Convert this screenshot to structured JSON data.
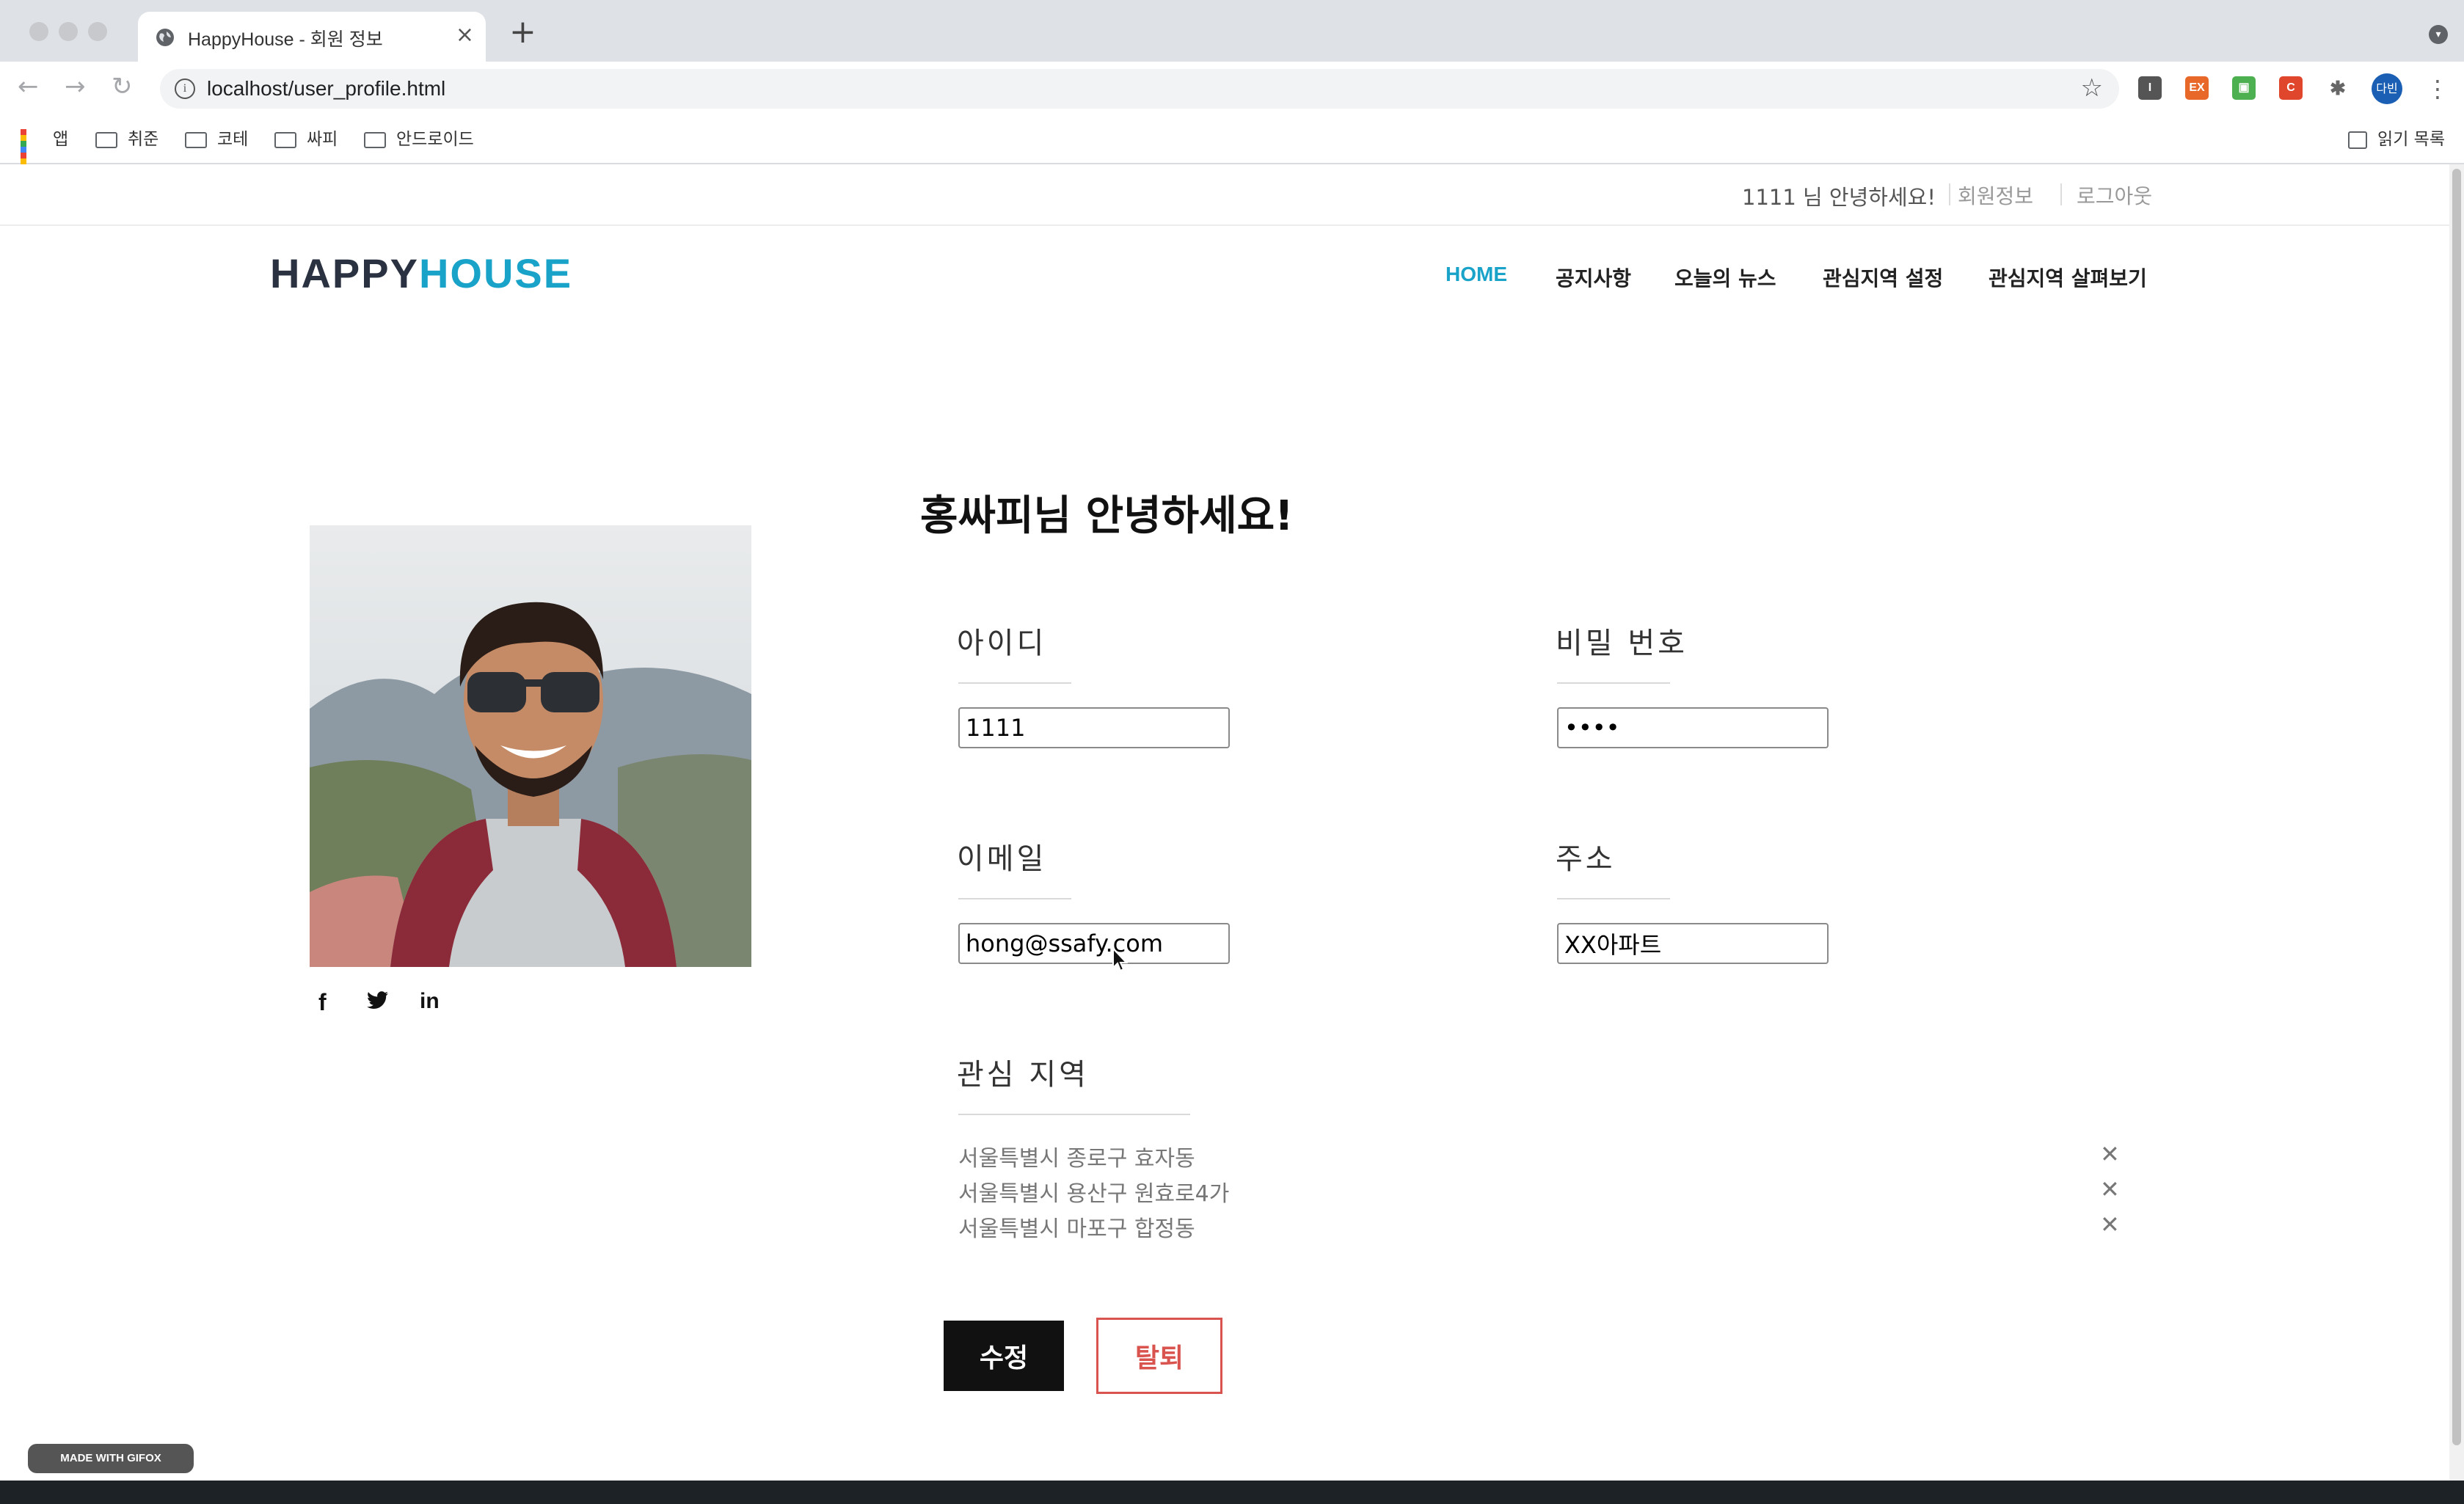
{
  "browser": {
    "tab_title": "HappyHouse - 회원 정보",
    "url": "localhost/user_profile.html",
    "profile_label": "다빈",
    "extensions": [
      {
        "label": "I",
        "color": "#555555"
      },
      {
        "label": "EX",
        "color": "#e8682a"
      },
      {
        "label": "▣",
        "color": "#4caf50"
      },
      {
        "label": "C",
        "color": "#e0462c"
      }
    ],
    "bookmarks": [
      "앱",
      "취준",
      "코테",
      "싸피",
      "안드로이드"
    ],
    "reading_list": "읽기 목록"
  },
  "topbar": {
    "greeting": "1111 님 안녕하세요!",
    "profile_link": "회원정보",
    "logout_link": "로그아웃"
  },
  "brand": {
    "part1": "HAPPY",
    "part2": "HOUSE"
  },
  "nav": [
    "HOME",
    "공지사항",
    "오늘의 뉴스",
    "관심지역 설정",
    "관심지역 살펴보기"
  ],
  "profile": {
    "welcome": "홍싸피님 안녕하세요!",
    "id_label": "아이디",
    "id_value": "1111",
    "password_label": "비밀 번호",
    "password_value": "1111",
    "email_label": "이메일",
    "email_value": "hong@ssafy.com",
    "address_label": "주소",
    "address_value": "XX아파트",
    "regions_label": "관심 지역",
    "regions": [
      "서울특별시 종로구 효자동",
      "서울특별시 용산구 원효로4가",
      "서울특별시 마포구 합정동"
    ],
    "remove_symbol": "✕",
    "edit_button": "수정",
    "withdraw_button": "탈퇴"
  },
  "social": {
    "facebook": "f",
    "twitter": "t",
    "linkedin": "in"
  },
  "badge": "MADE WITH GIFOX",
  "colors": {
    "accent": "#1aa3c9",
    "danger": "#d9534f",
    "dark": "#111111"
  }
}
